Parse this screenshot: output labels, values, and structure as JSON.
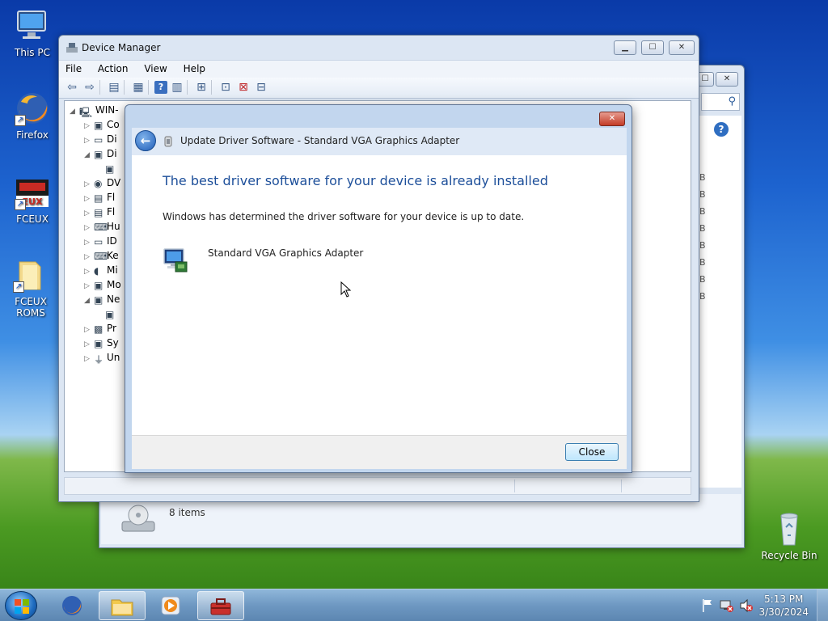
{
  "desktop": {
    "icons": [
      {
        "label": "This PC"
      },
      {
        "label": "Firefox"
      },
      {
        "label": "FCEUX"
      },
      {
        "label": "FCEUX ROMS"
      },
      {
        "label": "Recycle Bin"
      }
    ]
  },
  "explorer_window": {
    "items_count": "8 items",
    "size_fragments": [
      "B",
      "B",
      "B",
      "B",
      "B",
      "B",
      "B",
      "B"
    ]
  },
  "device_manager": {
    "title": "Device Manager",
    "menu": [
      "File",
      "Action",
      "View",
      "Help"
    ],
    "tree": [
      {
        "label": "WIN-",
        "expander": "◢"
      },
      {
        "label": "Co",
        "expander": "▷"
      },
      {
        "label": "Di",
        "expander": "▷"
      },
      {
        "label": "Di",
        "expander": "◢"
      },
      {
        "label": "",
        "expander": ""
      },
      {
        "label": "DV",
        "expander": "▷"
      },
      {
        "label": "Fl",
        "expander": "▷"
      },
      {
        "label": "Fl",
        "expander": "▷"
      },
      {
        "label": "Hu",
        "expander": "▷"
      },
      {
        "label": "ID",
        "expander": "▷"
      },
      {
        "label": "Ke",
        "expander": "▷"
      },
      {
        "label": "Mi",
        "expander": "▷"
      },
      {
        "label": "Mo",
        "expander": "▷"
      },
      {
        "label": "Ne",
        "expander": "◢"
      },
      {
        "label": "",
        "expander": ""
      },
      {
        "label": "Pr",
        "expander": "▷"
      },
      {
        "label": "Sy",
        "expander": "▷"
      },
      {
        "label": "Un",
        "expander": "▷"
      }
    ]
  },
  "dialog": {
    "title": "Update Driver Software - Standard VGA Graphics Adapter",
    "heading": "The best driver software for your device is already installed",
    "description": "Windows has determined the driver software for your device is up to date.",
    "device_name": "Standard VGA Graphics Adapter",
    "close_label": "Close",
    "close_x": "✕"
  },
  "taskbar": {
    "time": "5:13 PM",
    "date": "3/30/2024"
  },
  "colors": {
    "heading_blue": "#1d4f9a",
    "close_red": "#c33b26"
  }
}
